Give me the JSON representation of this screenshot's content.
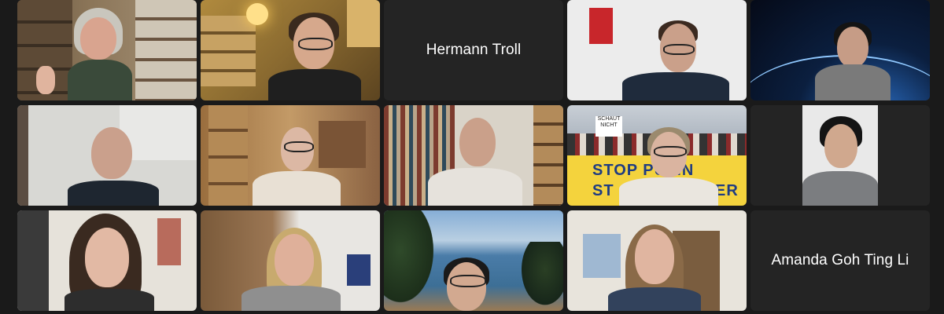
{
  "meeting": {
    "tiles": [
      {
        "type": "video"
      },
      {
        "type": "video"
      },
      {
        "type": "name",
        "name": "Hermann Troll"
      },
      {
        "type": "video"
      },
      {
        "type": "video"
      },
      {
        "type": "video"
      },
      {
        "type": "video"
      },
      {
        "type": "video"
      },
      {
        "type": "video",
        "banner": "STOP PUTIN",
        "banner2": "ST",
        "banner3": "ER",
        "sign": "SCHAUT NICHT"
      },
      {
        "type": "video"
      },
      {
        "type": "video"
      },
      {
        "type": "video"
      },
      {
        "type": "video"
      },
      {
        "type": "video"
      },
      {
        "type": "name",
        "name": "Amanda Goh Ting Li"
      }
    ]
  },
  "colors": {
    "background": "#1a1a1a",
    "tile": "#242424",
    "name_text": "#ffffff"
  }
}
